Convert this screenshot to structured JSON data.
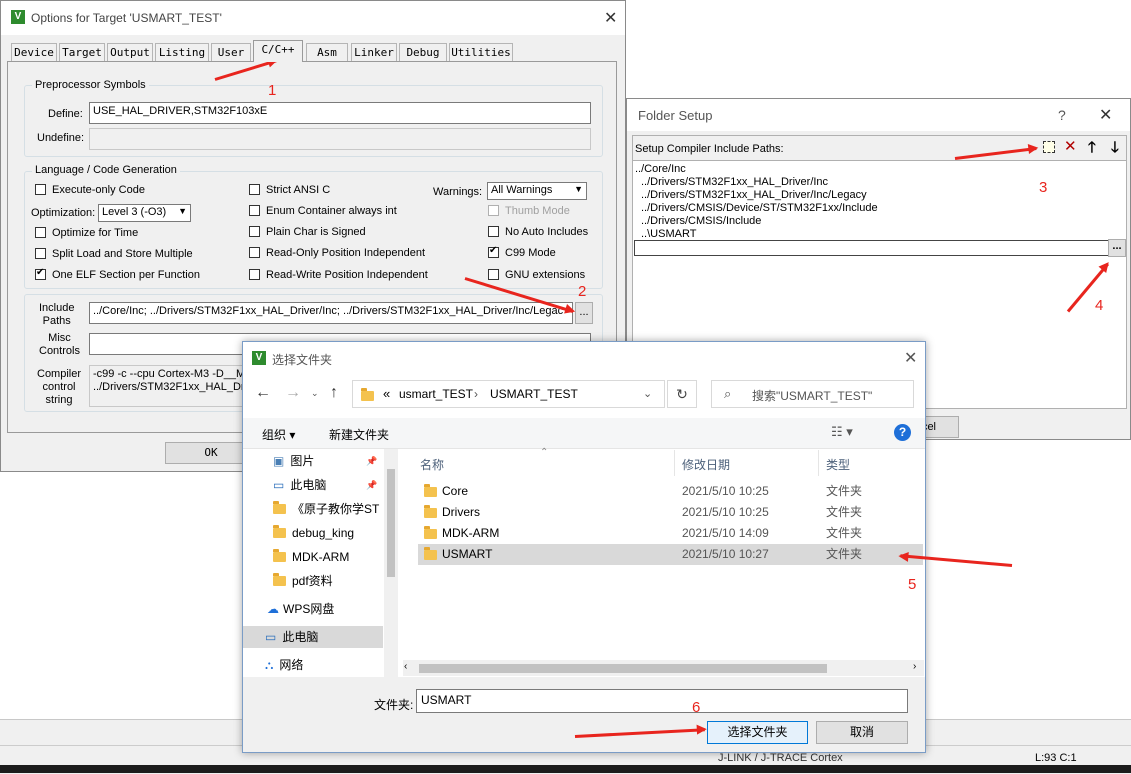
{
  "options_dialog": {
    "title": "Options for Target 'USMART_TEST'",
    "tabs": [
      "Device",
      "Target",
      "Output",
      "Listing",
      "User",
      "C/C++",
      "Asm",
      "Linker",
      "Debug",
      "Utilities"
    ],
    "active_tab": "C/C++",
    "preprocessor": {
      "group_title": "Preprocessor Symbols",
      "define_label": "Define:",
      "define_value": "USE_HAL_DRIVER,STM32F103xE",
      "undefine_label": "Undefine:",
      "undefine_value": ""
    },
    "language": {
      "group_title": "Language / Code Generation",
      "execute_only": "Execute-only Code",
      "optimization_label": "Optimization:",
      "optimization_value": "Level 3 (-O3)",
      "optimize_time": "Optimize for Time",
      "split_load": "Split Load and Store Multiple",
      "one_elf": "One ELF Section per Function",
      "strict_ansi": "Strict ANSI C",
      "enum_container": "Enum Container always int",
      "plain_char": "Plain Char is Signed",
      "ro_pi": "Read-Only Position Independent",
      "rw_pi": "Read-Write Position Independent",
      "warnings_label": "Warnings:",
      "warnings_value": "All Warnings",
      "thumb_mode": "Thumb Mode",
      "no_auto_includes": "No Auto Includes",
      "c99_mode": "C99 Mode",
      "gnu_extensions": "GNU extensions"
    },
    "include_label": "Include\nPaths",
    "include_value": "../Core/Inc;  ../Drivers/STM32F1xx_HAL_Driver/Inc;  ../Drivers/STM32F1xx_HAL_Driver/Inc/Legac",
    "browse_label": "...",
    "misc_label": "Misc\nControls",
    "misc_value": "",
    "compiler_label": "Compiler\ncontrol\nstring",
    "compiler_line1": "-c99 -c --cpu Cortex-M3 -D__MI",
    "compiler_line2": "../Drivers/STM32F1xx_HAL_Dri",
    "ok_label": "OK"
  },
  "folder_setup": {
    "title": "Folder Setup",
    "help": "?",
    "label": "Setup Compiler Include Paths:",
    "paths": [
      "../Core/Inc",
      "../Drivers/STM32F1xx_HAL_Driver/Inc",
      "../Drivers/STM32F1xx_HAL_Driver/Inc/Legacy",
      "../Drivers/CMSIS/Device/ST/STM32F1xx/Include",
      "../Drivers/CMSIS/Include",
      "..\\USMART"
    ],
    "browse_label": "...",
    "cancel_fragment": "cel"
  },
  "file_dialog": {
    "title": "选择文件夹",
    "breadcrumb_prefix": "«",
    "breadcrumb": [
      "usmart_TEST",
      "USMART_TEST"
    ],
    "search_placeholder": "搜索\"USMART_TEST\"",
    "organize": "组织 ▾",
    "new_folder": "新建文件夹",
    "nav": [
      {
        "label": "图片",
        "pin": true
      },
      {
        "label": "此电脑",
        "pin": true
      },
      {
        "label": "《原子教你学ST",
        "pin": false
      },
      {
        "label": "debug_king",
        "pin": false
      },
      {
        "label": "MDK-ARM",
        "pin": false
      },
      {
        "label": "pdf资料",
        "pin": false
      },
      {
        "label": "WPS网盘",
        "pin": false
      },
      {
        "label": "此电脑",
        "pin": false
      },
      {
        "label": "网络",
        "pin": false
      }
    ],
    "columns": {
      "name": "名称",
      "date": "修改日期",
      "type": "类型"
    },
    "files": [
      {
        "name": "Core",
        "date": "2021/5/10 10:25",
        "type": "文件夹"
      },
      {
        "name": "Drivers",
        "date": "2021/5/10 10:25",
        "type": "文件夹"
      },
      {
        "name": "MDK-ARM",
        "date": "2021/5/10 14:09",
        "type": "文件夹"
      },
      {
        "name": "USMART",
        "date": "2021/5/10 10:27",
        "type": "文件夹"
      }
    ],
    "selected_file": "USMART",
    "folder_label": "文件夹:",
    "folder_value": "USMART",
    "select_button": "选择文件夹",
    "cancel_button": "取消"
  },
  "status_bar": {
    "center_text": "J-LINK / J-TRACE Cortex",
    "position": "L:93 C:1"
  },
  "annotations": [
    "1",
    "2",
    "3",
    "4",
    "5",
    "6"
  ],
  "colors": {
    "annotation": "#e8251e",
    "selection": "#d9d9d9",
    "help_blue": "#1e6fd8"
  }
}
